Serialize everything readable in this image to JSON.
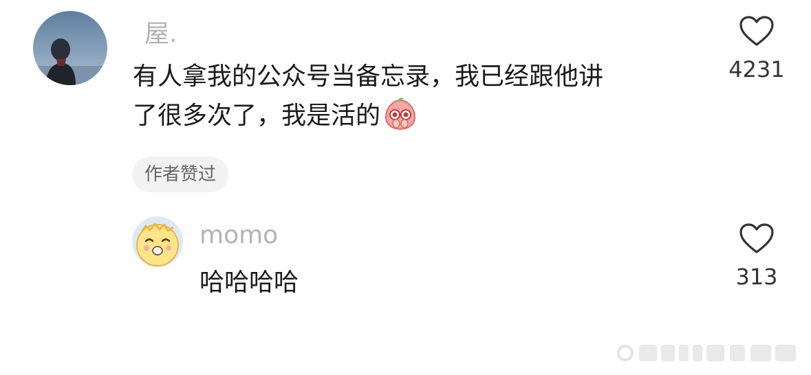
{
  "comments": [
    {
      "username": "屋.",
      "text_line1": "有人拿我的公众号当备忘录，我已经跟他讲",
      "text_line2": "了很多次了，我是活的",
      "emoji_icon": "crying-peach-face-icon",
      "likes": "4231",
      "author_badge": "作者赞过"
    },
    {
      "username": "momo",
      "text": "哈哈哈哈",
      "likes": "313"
    }
  ],
  "watermark_icon": "weibo-watermark-icon"
}
